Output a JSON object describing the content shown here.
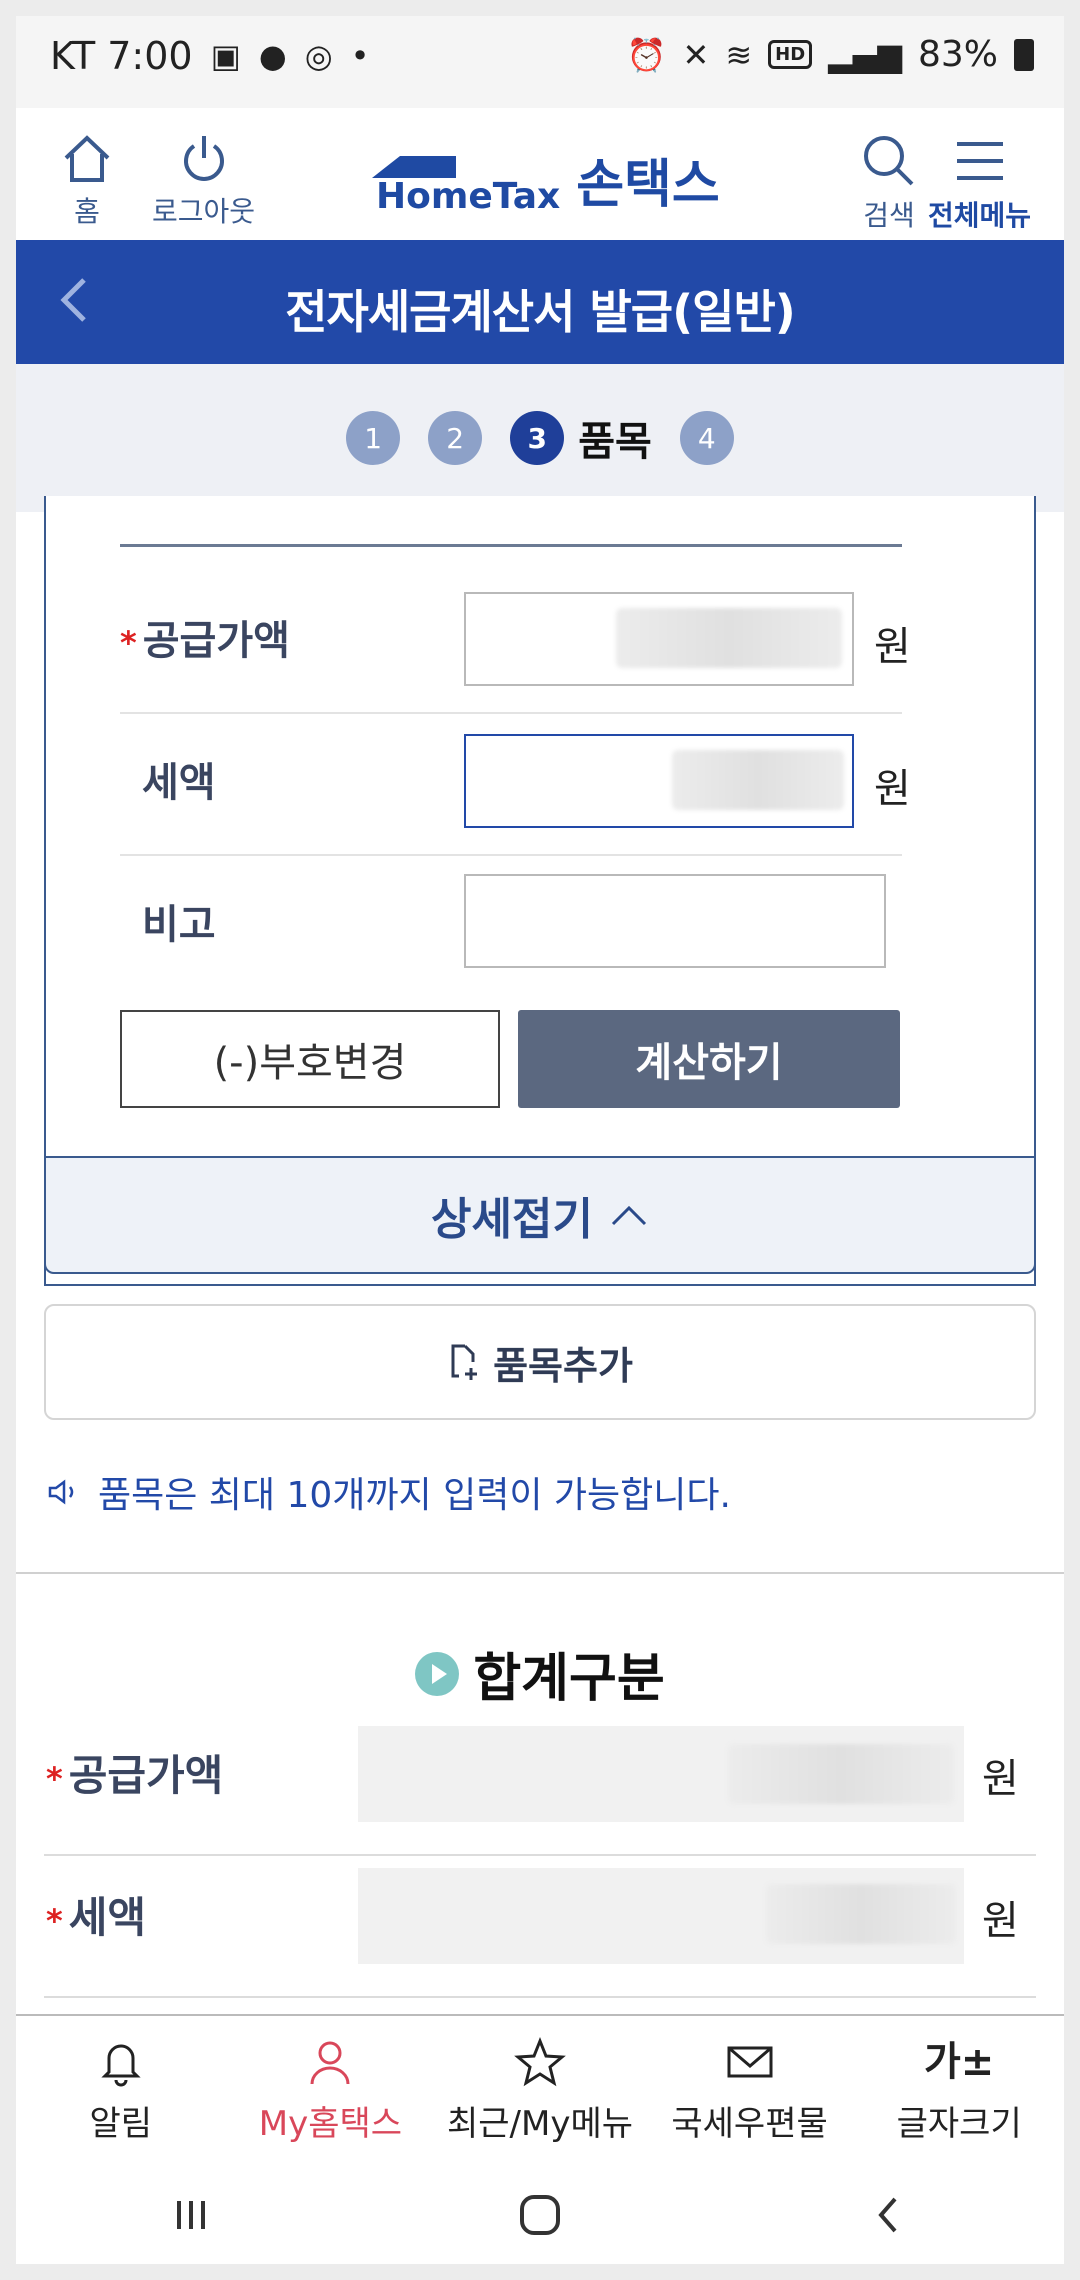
{
  "status_bar": {
    "carrier_time": "KT 7:00",
    "battery": "83%",
    "hd": "HD"
  },
  "header": {
    "home_label": "홈",
    "logout_label": "로그아웃",
    "logo_en": "HomeTax",
    "logo_ko": "손택스",
    "search_label": "검색",
    "menu_label": "전체메뉴"
  },
  "title_bar": {
    "title": "전자세금계산서 발급(일반)"
  },
  "stepper": {
    "steps": [
      "1",
      "2",
      "3",
      "4"
    ],
    "active_label": "품목"
  },
  "item_form": {
    "required_mark": "*",
    "supply_label": "공급가액",
    "tax_label": "세액",
    "note_label": "비고",
    "unit": "원",
    "sign_button": "(-)부호변경",
    "calc_button": "계산하기",
    "fold_label": "상세접기"
  },
  "add_item": {
    "label": "품목추가"
  },
  "notice": {
    "text": "품목은 최대 10개까지 입력이 가능합니다."
  },
  "summary": {
    "title": "합계구분",
    "supply_label": "공급가액",
    "tax_label": "세액",
    "unit": "원"
  },
  "bottom_nav": {
    "items": [
      "알림",
      "My홈택스",
      "최근/My메뉴",
      "국세우편물",
      "글자크기"
    ],
    "font_icon": "가±",
    "active_color": "#d9475a"
  },
  "colors": {
    "primary": "#2249a8",
    "accent_text": "#3a4560"
  }
}
